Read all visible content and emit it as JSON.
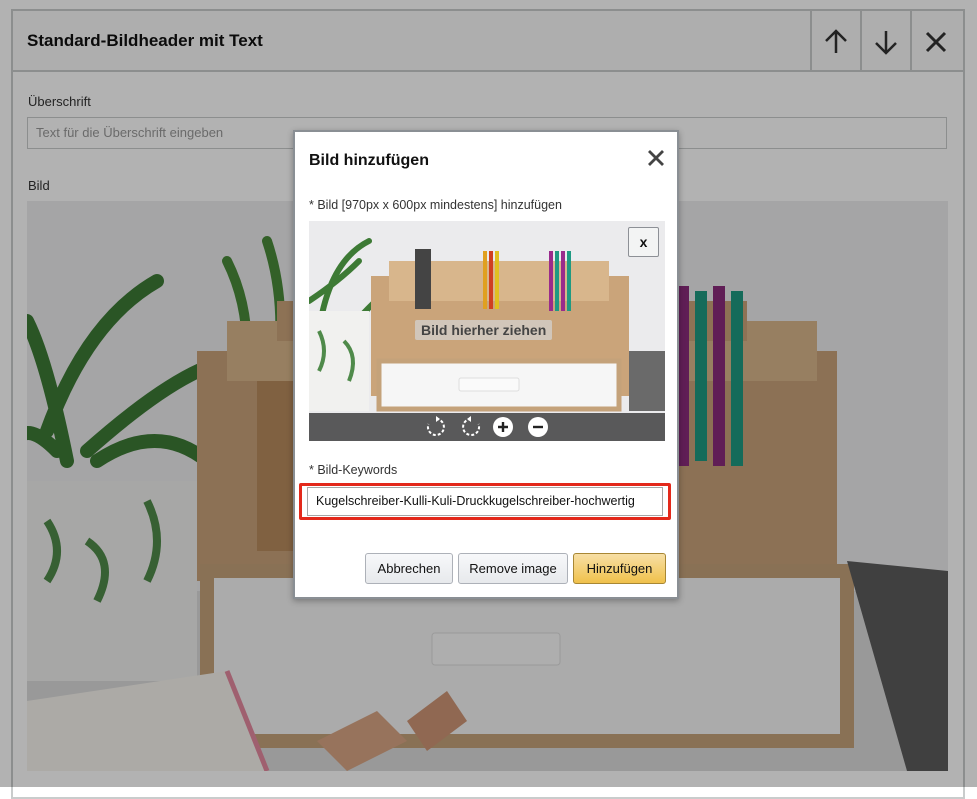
{
  "module": {
    "title": "Standard-Bildheader mit Text",
    "heading_label": "Überschrift",
    "heading_placeholder": "Text für die Überschrift eingeben",
    "image_label": "Bild"
  },
  "modal": {
    "title": "Bild hinzufügen",
    "image_label": "* Bild [970px x 600px mindestens] hinzufügen",
    "remove_preview": "x",
    "drag_hint": "Bild hierher ziehen",
    "keywords_label": "* Bild-Keywords",
    "keywords_value": "Kugelschreiber-Kulli-Kuli-Druckkugelschreiber-hochwertig",
    "buttons": {
      "cancel": "Abbrechen",
      "remove": "Remove image",
      "add": "Hinzufügen"
    }
  },
  "colors": {
    "highlight": "#e3291b",
    "primary_button": "#f0c14b"
  },
  "icons": {
    "move_up": "arrow-up-icon",
    "move_down": "arrow-down-icon",
    "close": "close-icon",
    "rotate_cw": "rotate-clockwise-icon",
    "rotate_ccw": "rotate-counterclockwise-icon",
    "zoom_in": "zoom-in-icon",
    "zoom_out": "zoom-out-icon"
  }
}
